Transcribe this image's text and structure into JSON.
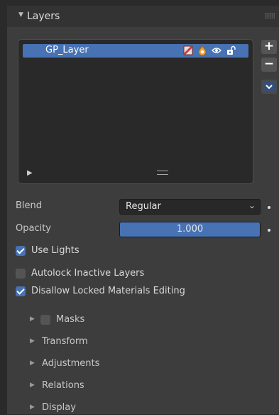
{
  "panel": {
    "title": "Layers"
  },
  "layer_list": {
    "items": [
      {
        "name": "GP_Layer",
        "selected": true
      }
    ]
  },
  "side_buttons": {
    "add": "+",
    "remove": "−",
    "menu": "⌄"
  },
  "blend": {
    "label": "Blend",
    "value": "Regular"
  },
  "opacity": {
    "label": "Opacity",
    "value": "1.000"
  },
  "use_lights": {
    "label": "Use Lights",
    "checked": true
  },
  "autolock": {
    "label": "Autolock Inactive Layers",
    "checked": false
  },
  "disallow_locked": {
    "label": "Disallow Locked Materials Editing",
    "checked": true
  },
  "subpanels": {
    "masks": "Masks",
    "transform": "Transform",
    "adjustments": "Adjustments",
    "relations": "Relations",
    "display": "Display"
  },
  "colors": {
    "accent": "#4772b3",
    "panel_bg": "#3d3d3d"
  }
}
